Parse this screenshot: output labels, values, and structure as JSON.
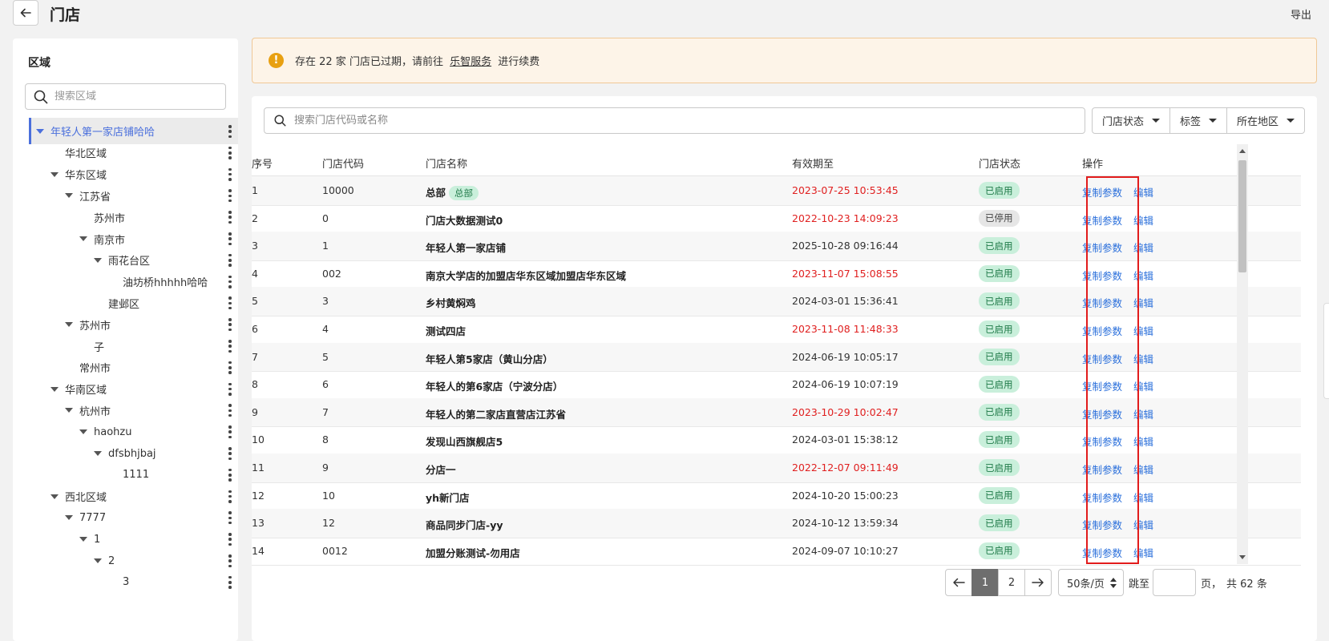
{
  "header": {
    "title": "门店",
    "export_label": "导出"
  },
  "sidebar": {
    "title": "区域",
    "search_placeholder": "搜索区域",
    "tree": [
      {
        "label": "年轻人第一家店铺哈哈",
        "depth": 0,
        "expandable": true,
        "selected": true
      },
      {
        "label": "华北区域",
        "depth": 1,
        "expandable": false
      },
      {
        "label": "华东区域",
        "depth": 1,
        "expandable": true
      },
      {
        "label": "江苏省",
        "depth": 2,
        "expandable": true
      },
      {
        "label": "苏州市",
        "depth": 3,
        "expandable": false
      },
      {
        "label": "南京市",
        "depth": 3,
        "expandable": true
      },
      {
        "label": "雨花台区",
        "depth": 4,
        "expandable": true
      },
      {
        "label": "油坊桥hhhhh哈哈",
        "depth": 5,
        "expandable": false
      },
      {
        "label": "建邺区",
        "depth": 4,
        "expandable": false
      },
      {
        "label": "苏州市",
        "depth": 2,
        "expandable": true
      },
      {
        "label": "子",
        "depth": 3,
        "expandable": false
      },
      {
        "label": "常州市",
        "depth": 2,
        "expandable": false
      },
      {
        "label": "华南区域",
        "depth": 1,
        "expandable": true
      },
      {
        "label": "杭州市",
        "depth": 2,
        "expandable": true
      },
      {
        "label": "haohzu",
        "depth": 3,
        "expandable": true
      },
      {
        "label": "dfsbhjbaj",
        "depth": 4,
        "expandable": true
      },
      {
        "label": "1111",
        "depth": 5,
        "expandable": false
      },
      {
        "label": "西北区域",
        "depth": 1,
        "expandable": true
      },
      {
        "label": "7777",
        "depth": 2,
        "expandable": true
      },
      {
        "label": "1",
        "depth": 3,
        "expandable": true
      },
      {
        "label": "2",
        "depth": 4,
        "expandable": true
      },
      {
        "label": "3",
        "depth": 5,
        "expandable": false
      }
    ]
  },
  "notice": {
    "icon": "!",
    "text_before": "存在 22 家 门店已过期，请前往",
    "link": "乐智服务",
    "text_after": "进行续费"
  },
  "toolbar": {
    "search_placeholder": "搜索门店代码或名称",
    "filters": [
      "门店状态",
      "标签",
      "所在地区"
    ]
  },
  "table": {
    "columns": [
      "序号",
      "门店代码",
      "门店名称",
      "有效期至",
      "门店状态",
      "操作"
    ],
    "hq_tag": "总部",
    "actions": {
      "copy": "复制参数",
      "edit": "编辑"
    },
    "rows": [
      {
        "no": "1",
        "code": "10000",
        "name": "总部",
        "hq": true,
        "valid_until": "2023-07-25 10:53:45",
        "expired": true,
        "status": "已启用",
        "enabled": true
      },
      {
        "no": "2",
        "code": "0",
        "name": "门店大数据测试0",
        "hq": false,
        "valid_until": "2022-10-23 14:09:23",
        "expired": true,
        "status": "已停用",
        "enabled": false
      },
      {
        "no": "3",
        "code": "1",
        "name": "年轻人第一家店铺",
        "hq": false,
        "valid_until": "2025-10-28 09:16:44",
        "expired": false,
        "status": "已启用",
        "enabled": true
      },
      {
        "no": "4",
        "code": "002",
        "name": "南京大学店的加盟店华东区域加盟店华东区域",
        "hq": false,
        "valid_until": "2023-11-07 15:08:55",
        "expired": true,
        "status": "已启用",
        "enabled": true
      },
      {
        "no": "5",
        "code": "3",
        "name": "乡村黄焖鸡",
        "hq": false,
        "valid_until": "2024-03-01 15:36:41",
        "expired": false,
        "status": "已启用",
        "enabled": true
      },
      {
        "no": "6",
        "code": "4",
        "name": "测试四店",
        "hq": false,
        "valid_until": "2023-11-08 11:48:33",
        "expired": true,
        "status": "已启用",
        "enabled": true
      },
      {
        "no": "7",
        "code": "5",
        "name": "年轻人第5家店（黄山分店）",
        "hq": false,
        "valid_until": "2024-06-19 10:05:17",
        "expired": false,
        "status": "已启用",
        "enabled": true
      },
      {
        "no": "8",
        "code": "6",
        "name": "年轻人的第6家店（宁波分店）",
        "hq": false,
        "valid_until": "2024-06-19 10:07:19",
        "expired": false,
        "status": "已启用",
        "enabled": true
      },
      {
        "no": "9",
        "code": "7",
        "name": "年轻人的第二家店直营店江苏省",
        "hq": false,
        "valid_until": "2023-10-29 10:02:47",
        "expired": true,
        "status": "已启用",
        "enabled": true
      },
      {
        "no": "10",
        "code": "8",
        "name": "发现山西旗舰店5",
        "hq": false,
        "valid_until": "2024-03-01 15:38:12",
        "expired": false,
        "status": "已启用",
        "enabled": true
      },
      {
        "no": "11",
        "code": "9",
        "name": "分店一",
        "hq": false,
        "valid_until": "2022-12-07 09:11:49",
        "expired": true,
        "status": "已启用",
        "enabled": true
      },
      {
        "no": "12",
        "code": "10",
        "name": "yh新门店",
        "hq": false,
        "valid_until": "2024-10-20 15:00:23",
        "expired": false,
        "status": "已启用",
        "enabled": true
      },
      {
        "no": "13",
        "code": "12",
        "name": "商品同步门店-yy",
        "hq": false,
        "valid_until": "2024-10-12 13:59:34",
        "expired": false,
        "status": "已启用",
        "enabled": true
      },
      {
        "no": "14",
        "code": "0012",
        "name": "加盟分账测试-勿用店",
        "hq": false,
        "valid_until": "2024-09-07 10:10:27",
        "expired": false,
        "status": "已启用",
        "enabled": true
      }
    ]
  },
  "pagination": {
    "pages": [
      "1",
      "2"
    ],
    "current": "1",
    "page_size": "50条/页",
    "jump_label": "跳至",
    "jump_value": "",
    "page_suffix": "页，",
    "total_text": "共 62 条"
  },
  "colors": {
    "accent": "#4a6fdc",
    "link": "#2a6fdb",
    "expired": "#e02020",
    "enabled_bg": "#c9efdb",
    "highlight": "#e21c1c"
  }
}
